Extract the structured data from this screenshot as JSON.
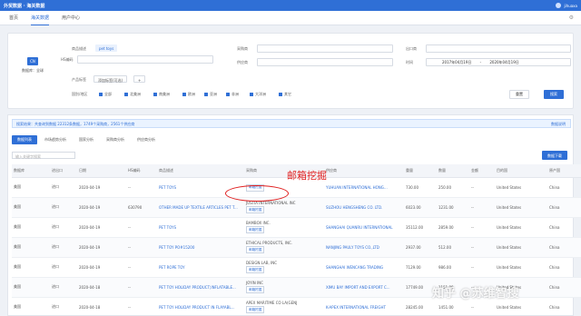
{
  "app": {
    "title": "外贸数据 · 海关数据",
    "user": "jihuaxa"
  },
  "nav": [
    {
      "label": "首页",
      "active": false
    },
    {
      "label": "海关数据",
      "active": true
    },
    {
      "label": "用户中心",
      "active": false
    }
  ],
  "filters": {
    "region_label": "CN",
    "region_name": "数据库：全球",
    "product_desc_label": "商品描述",
    "product_tag": "pet toys",
    "hs_label": "HS编码",
    "purchaser_label": "采购商",
    "supplier_label": "供应商",
    "supplier2_label": "出口商",
    "date_label": "时间",
    "date_from": "2017年04月19日",
    "date_sep": "-",
    "date_to": "2020年04月19日",
    "product_tags_label": "产品标签",
    "tag_btn": "添加标签(可选)",
    "tag_btn2": "+",
    "region_filter_label": "国别/地区",
    "regions": [
      "全部",
      "北美洲",
      "南美洲",
      "欧洲",
      "亚洲",
      "非洲",
      "大洋洲",
      "其它"
    ],
    "reset_label": "重置",
    "search_label": "搜索"
  },
  "notice": {
    "text": "搜索结果：共查询到数据 22312条数据，1749个采购商，2561个供应商",
    "right": "数据说明"
  },
  "tabs": [
    {
      "label": "数据列表",
      "active": true
    },
    {
      "label": "市场趋势分析",
      "active": false
    },
    {
      "label": "国家分析",
      "active": false
    },
    {
      "label": "采购商分析",
      "active": false
    },
    {
      "label": "供应商分析",
      "active": false
    }
  ],
  "table": {
    "search_placeholder": "输入关键字搜索",
    "download_label": "数据下载",
    "mail_btn": "邮箱挖掘",
    "headers": [
      "数据库",
      "进出口",
      "日期",
      "HS编码",
      "商品描述",
      "采购商",
      "供应商",
      "重量",
      "数量",
      "金额",
      "目的国",
      "原产国"
    ],
    "rows": [
      [
        "美国",
        "进口",
        "2020-04-19",
        "--",
        "PET TOYS",
        "",
        "YUHUAN INTERNATIONAL HONG...",
        "730.00",
        "250.00",
        "--",
        "United States",
        "China"
      ],
      [
        "美国",
        "进口",
        "2020-04-19",
        "630790",
        "OTHER MADE UP TEXTILE ARTICLES PET T...",
        "JUSTIA INTERNATIONAL INC",
        "SUZHOU HENGSHENG CO. LTD.",
        "6023.00",
        "1231.00",
        "--",
        "United States",
        "China"
      ],
      [
        "美国",
        "进口",
        "2020-04-19",
        "--",
        "PET TOYS",
        "BAMBOX INC.",
        "SHANGHAI QUANRU INTERNATIONAL",
        "35112.00",
        "2859.00",
        "--",
        "United States",
        "China"
      ],
      [
        "美国",
        "进口",
        "2020-04-19",
        "--",
        "PET TOY PO#15200",
        "ETHICAL PRODUCTS, INC.",
        "NANJING PAULY TOYS CO.,LTD",
        "2937.00",
        "512.00",
        "--",
        "United States",
        "China"
      ],
      [
        "美国",
        "进口",
        "2020-04-19",
        "--",
        "PET ROPE TOY",
        "DESIGN LAB, INC",
        "SHANGHAI WENCANG TRADING",
        "7129.00",
        "986.00",
        "--",
        "United States",
        "China"
      ],
      [
        "美国",
        "进口",
        "2020-04-18",
        "--",
        "PET TOY HOLIDAY PRODUCT;INFLATABLE...",
        "JOYIN INC",
        "XIMU BAY IMPORT AND EXPORT C...",
        "17749.00",
        "1151.00",
        "--",
        "United States",
        "China"
      ],
      [
        "美国",
        "进口",
        "2020-04-18",
        "--",
        "PET TOY HOLIDAY PRODUCT IN FLAYABL...",
        "APEX MARITIME CO LA(GENJ",
        "K-APEX INTERNATIONAL FREIGHT",
        "28245.00",
        "1451.00",
        "--",
        "United States",
        "China"
      ]
    ]
  },
  "annotation": {
    "text": "邮箱挖掘"
  },
  "watermark": "知乎 @苏维智搜",
  "colors": {
    "primary": "#2f6fd6",
    "annotation": "#e02020"
  }
}
